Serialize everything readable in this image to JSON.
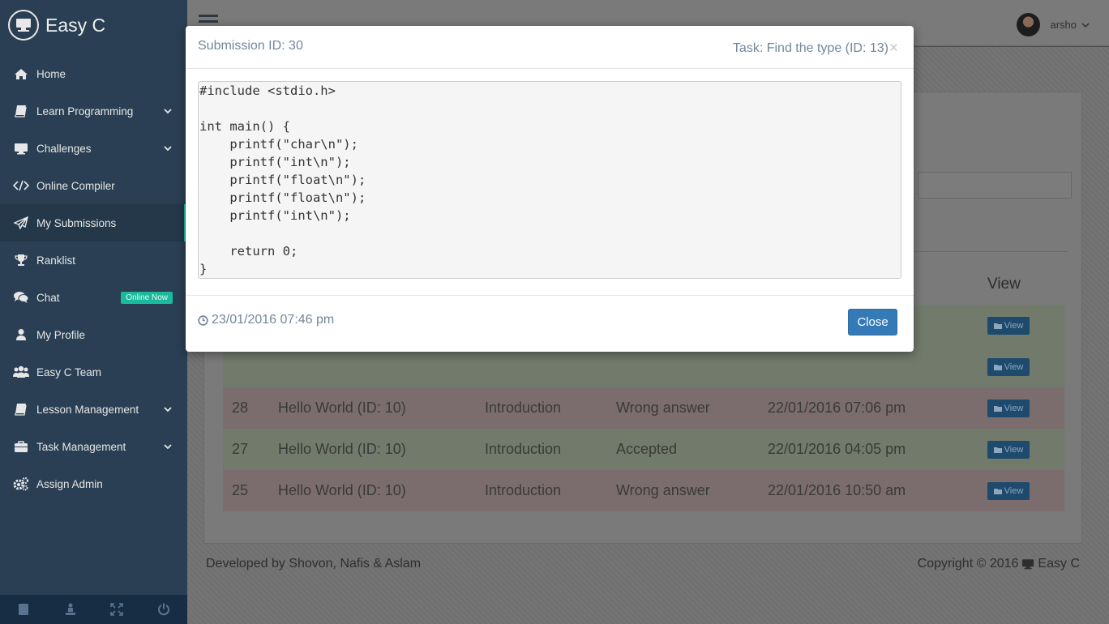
{
  "brand": {
    "title": "Easy C"
  },
  "sidebar": {
    "items": [
      {
        "label": "Home",
        "icon": "home-icon"
      },
      {
        "label": "Learn Programming",
        "icon": "book-icon",
        "expandable": true
      },
      {
        "label": "Challenges",
        "icon": "desktop-icon",
        "expandable": true
      },
      {
        "label": "Online Compiler",
        "icon": "code-icon"
      },
      {
        "label": "My Submissions",
        "icon": "paper-plane-icon",
        "active": true
      },
      {
        "label": "Ranklist",
        "icon": "trophy-icon"
      },
      {
        "label": "Chat",
        "icon": "comments-icon",
        "badge": "Online Now"
      },
      {
        "label": "My Profile",
        "icon": "user-icon"
      },
      {
        "label": "Easy C Team",
        "icon": "users-icon"
      },
      {
        "label": "Lesson Management",
        "icon": "book-icon",
        "expandable": true
      },
      {
        "label": "Task Management",
        "icon": "briefcase-icon",
        "expandable": true
      },
      {
        "label": "Assign Admin",
        "icon": "cogs-icon"
      }
    ],
    "footer_icons": [
      "book-icon",
      "chess-icon",
      "expand-icon",
      "power-icon"
    ]
  },
  "topnav": {
    "username": "arsho"
  },
  "table": {
    "view_header": "View",
    "view_button_label": "View",
    "rows": [
      {
        "id": "",
        "task": "",
        "category": "",
        "status": "",
        "time": "",
        "state": "accepted"
      },
      {
        "id": "",
        "task": "",
        "category": "",
        "status": "",
        "time": "",
        "state": "accepted"
      },
      {
        "id": "28",
        "task": "Hello World (ID: 10)",
        "category": "Introduction",
        "status": "Wrong answer",
        "time": "22/01/2016 07:06 pm",
        "state": "wrong"
      },
      {
        "id": "27",
        "task": "Hello World (ID: 10)",
        "category": "Introduction",
        "status": "Accepted",
        "time": "22/01/2016 04:05 pm",
        "state": "accepted"
      },
      {
        "id": "25",
        "task": "Hello World (ID: 10)",
        "category": "Introduction",
        "status": "Wrong answer",
        "time": "22/01/2016 10:50 am",
        "state": "wrong"
      }
    ]
  },
  "footer": {
    "developed": "Developed by Shovon, Nafis & Aslam",
    "copyright": "Copyright © 2016",
    "brand": "Easy C"
  },
  "modal": {
    "title": "Submission ID: 30",
    "task": "Task: Find the type (ID: 13)",
    "close_x": "×",
    "code": "#include <stdio.h>\n\nint main() {\n    printf(\"char\\n\");\n    printf(\"int\\n\");\n    printf(\"float\\n\");\n    printf(\"float\\n\");\n    printf(\"int\\n\");\n\n    return 0;\n}",
    "timestamp": "23/01/2016 07:46 pm",
    "close_button": "Close"
  },
  "colors": {
    "sidebar_bg": "#2a3f54",
    "active_accent": "#1abb9c",
    "primary_button": "#337ab7",
    "modal_text": "#73879c"
  }
}
